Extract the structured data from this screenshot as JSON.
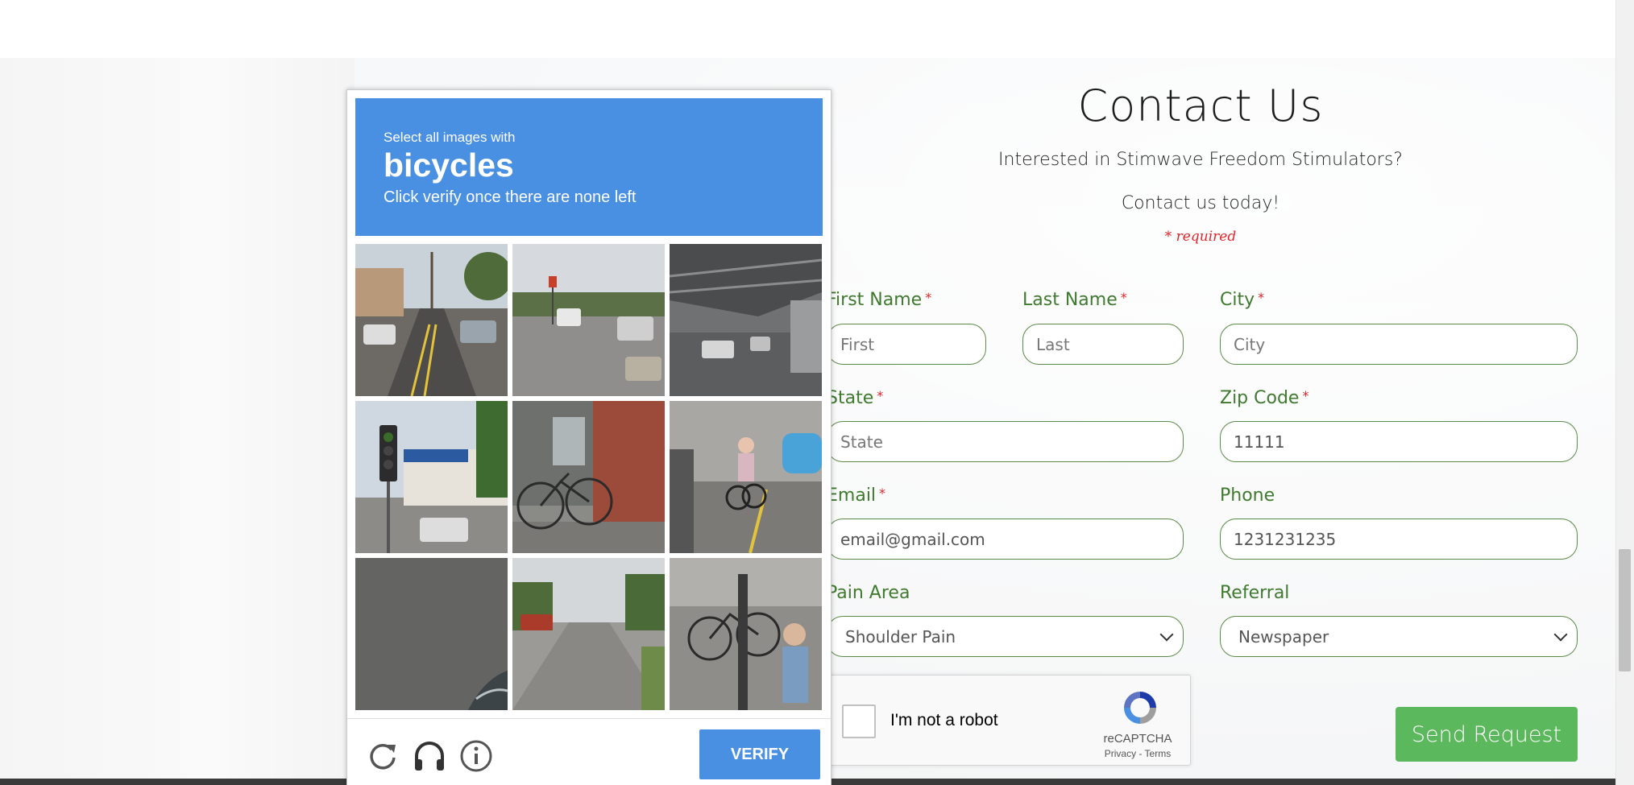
{
  "contact": {
    "title": "Contact Us",
    "subtitle": "Interested in Stimwave Freedom Stimulators?",
    "cta": "Contact us today!",
    "required_note": "* required"
  },
  "form": {
    "first_name": {
      "label": "First Name",
      "placeholder": "First"
    },
    "last_name": {
      "label": "Last Name",
      "placeholder": "Last"
    },
    "city": {
      "label": "City",
      "placeholder": "City"
    },
    "state": {
      "label": "State",
      "placeholder": "State"
    },
    "zip": {
      "label": "Zip Code",
      "value": "11111"
    },
    "email": {
      "label": "Email",
      "value": "email@gmail.com"
    },
    "phone": {
      "label": "Phone",
      "value": "1231231235"
    },
    "pain_area": {
      "label": "Pain Area",
      "selected": "Shoulder Pain"
    },
    "referral": {
      "label": "Referral",
      "selected": "Newspaper"
    },
    "required_star": "*",
    "send_label": "Send Request"
  },
  "recaptcha_anchor": {
    "label": "I'm not a robot",
    "brand": "reCAPTCHA",
    "links": "Privacy - Terms"
  },
  "challenge": {
    "instruction_pre": "Select all images with",
    "target": "bicycles",
    "instruction_post": "Click verify once there are none left",
    "verify_label": "VERIFY",
    "footer_icons": [
      "reload-icon",
      "headphones-icon",
      "info-icon"
    ],
    "accent_color": "#4a90e2",
    "tiles": [
      {
        "scene": "residential street with parked cars and palm trees"
      },
      {
        "scene": "intersection with traffic light and cars"
      },
      {
        "scene": "street under elevated steel bridge"
      },
      {
        "scene": "traffic light in front of Rite Aid sign"
      },
      {
        "scene": "bicycle parked next to brick wall"
      },
      {
        "scene": "cyclist riding on street beside blue car"
      },
      {
        "scene": "asphalt ground close-up"
      },
      {
        "scene": "empty residential road with trees"
      },
      {
        "scene": "parked bicycles and pedestrian on sidewalk"
      }
    ]
  },
  "colors": {
    "label_green": "#3f7a2f",
    "border_green": "#5b8a47",
    "required_red": "#e0262a",
    "button_green": "#5cb85c"
  }
}
